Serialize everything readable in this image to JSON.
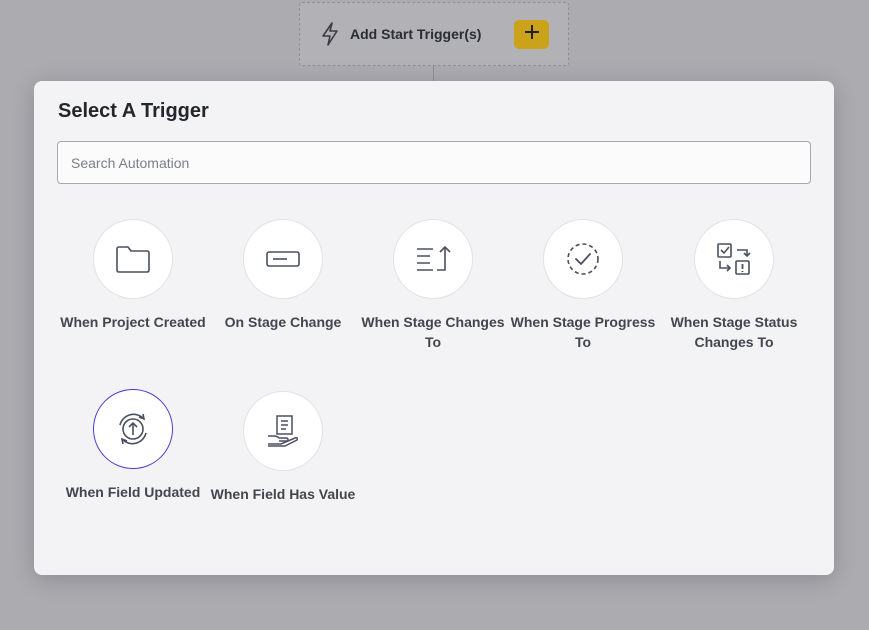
{
  "canvas": {
    "start_trigger_label": "Add Start Trigger(s)",
    "start_trigger_icon": "lightning-bolt-icon",
    "add_icon": "plus-icon",
    "accent": "#caa31a"
  },
  "modal": {
    "title": "Select A Trigger",
    "search_placeholder": "Search Automation",
    "search_value": "",
    "selected_color": "#4a3fd0",
    "triggers": [
      {
        "label": "When Project Created",
        "icon": "folder-icon"
      },
      {
        "label": "On Stage Change",
        "icon": "stage-bar-icon"
      },
      {
        "label": "When Stage Changes To",
        "icon": "list-return-icon"
      },
      {
        "label": "When Stage Progress To",
        "icon": "progress-check-icon"
      },
      {
        "label": "When Stage Status Changes To",
        "icon": "status-swap-icon"
      },
      {
        "label": "When Field Updated",
        "icon": "refresh-upload-icon",
        "selected": true
      },
      {
        "label": "When Field Has Value",
        "icon": "document-hand-icon"
      }
    ]
  }
}
